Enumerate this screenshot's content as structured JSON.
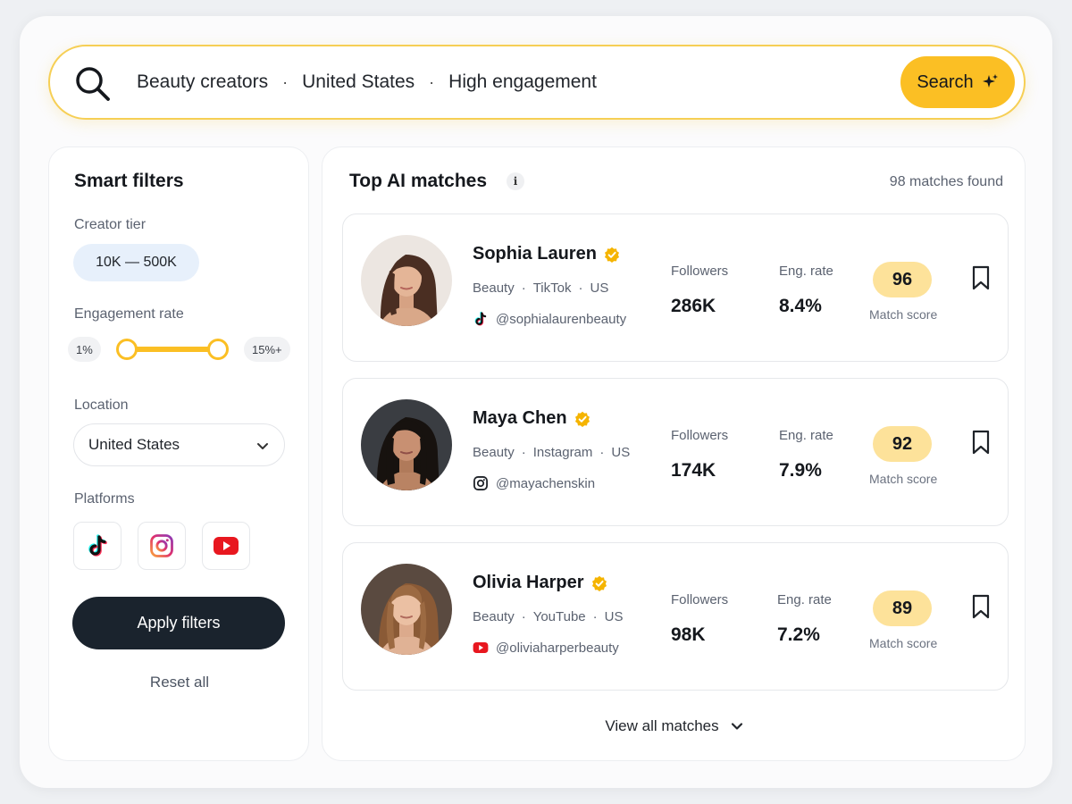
{
  "search": {
    "terms": [
      "Beauty creators",
      "United States",
      "High engagement"
    ],
    "separator": "·",
    "button_label": "Search"
  },
  "filters": {
    "title": "Smart filters",
    "tier_label": "Creator tier",
    "tier_value": "10K — 500K",
    "engagement_label": "Engagement rate",
    "engagement_min": "1%",
    "engagement_max": "15%+",
    "location_label": "Location",
    "location_value": "United States",
    "platforms_label": "Platforms",
    "platforms": [
      "tiktok-icon",
      "instagram-icon",
      "youtube-icon"
    ],
    "apply_label": "Apply filters",
    "reset_label": "Reset all"
  },
  "matches": {
    "title": "Top AI matches",
    "count_text": "98 matches found",
    "followers_label": "Followers",
    "eng_label": "Eng. rate",
    "score_label": "Match score",
    "view_all_label": "View all matches",
    "creators": [
      {
        "name": "Sophia Lauren",
        "category": "Beauty",
        "platform": "TikTok",
        "country": "US",
        "handle": "@sophialaurenbeauty",
        "followers": "286K",
        "eng_rate": "8.4%",
        "score": "96"
      },
      {
        "name": "Maya Chen",
        "category": "Beauty",
        "platform": "Instagram",
        "country": "US",
        "handle": "@mayachenskin",
        "followers": "174K",
        "eng_rate": "7.9%",
        "score": "92"
      },
      {
        "name": "Olivia Harper",
        "category": "Beauty",
        "platform": "YouTube",
        "country": "US",
        "handle": "@oliviaharperbeauty",
        "followers": "98K",
        "eng_rate": "7.2%",
        "score": "89"
      }
    ]
  },
  "colors": {
    "accent": "#fbbf24",
    "accent_soft": "#fde29a",
    "dark_button": "#1a232d",
    "verified": "#f5b400"
  }
}
